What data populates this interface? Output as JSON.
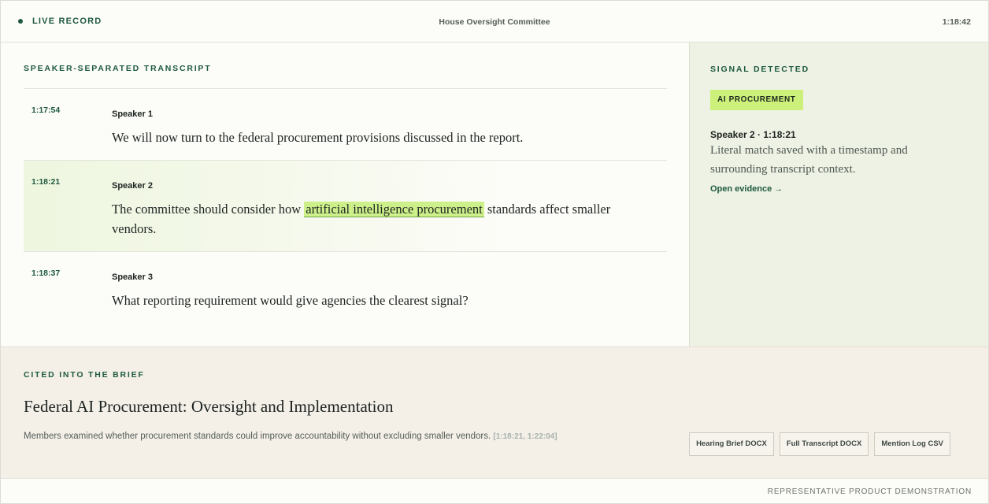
{
  "topbar": {
    "live_label": "LIVE RECORD",
    "committee": "House Oversight Committee",
    "clock": "1:18:42",
    "live_dot_color": "#1f5a40"
  },
  "transcript": {
    "section_label": "SPEAKER-SEPARATED TRANSCRIPT",
    "rows": [
      {
        "timestamp": "1:17:54",
        "speaker": "Speaker 1",
        "text": "We will now turn to the federal procurement provisions discussed in the report."
      },
      {
        "timestamp": "1:18:21",
        "speaker": "Speaker 2",
        "text_before": "The committee should consider how ",
        "highlight": "artificial intelligence procurement",
        "text_after": " standards affect smaller vendors.",
        "highlighted": true
      },
      {
        "timestamp": "1:18:37",
        "speaker": "Speaker 3",
        "text": "What reporting requirement would give agencies the clearest signal?"
      }
    ]
  },
  "signal": {
    "section_label": "SIGNAL DETECTED",
    "tag": "AI PROCUREMENT",
    "speaker_time": "Speaker 2 · 1:18:21",
    "description": "Literal match saved with a timestamp and surrounding transcript context.",
    "link": "Open evidence →",
    "tag_color": "#cdf07a"
  },
  "brief": {
    "section_label": "CITED INTO THE BRIEF",
    "title": "Federal AI Procurement: Oversight and Implementation",
    "summary": "Members examined whether procurement standards could improve accountability without excluding smaller vendors.",
    "citation": "[1:18:21, 1:22:04]",
    "downloads": [
      "Hearing Brief DOCX",
      "Full Transcript DOCX",
      "Mention Log CSV"
    ]
  },
  "footer": {
    "text": "REPRESENTATIVE PRODUCT DEMONSTRATION"
  }
}
